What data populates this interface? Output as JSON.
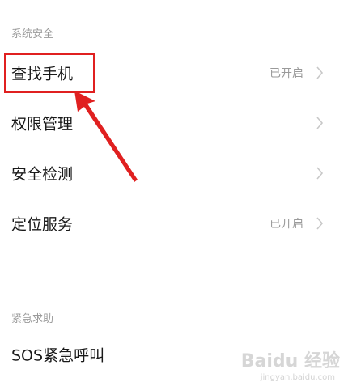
{
  "sections": {
    "system_security": {
      "title": "系统安全"
    },
    "emergency": {
      "title": "紧急求助"
    }
  },
  "items": {
    "find_phone": {
      "label": "查找手机",
      "value": "已开启"
    },
    "permissions": {
      "label": "权限管理"
    },
    "security_scan": {
      "label": "安全检测"
    },
    "location": {
      "label": "定位服务",
      "value": "已开启"
    },
    "sos": {
      "label": "SOS紧急呼叫"
    }
  },
  "watermark": {
    "text": "Baidu 经验",
    "sub": "jingyan.baidu.com"
  },
  "colors": {
    "annotation": "#e02020",
    "secondary_text": "#9a9a9a"
  }
}
